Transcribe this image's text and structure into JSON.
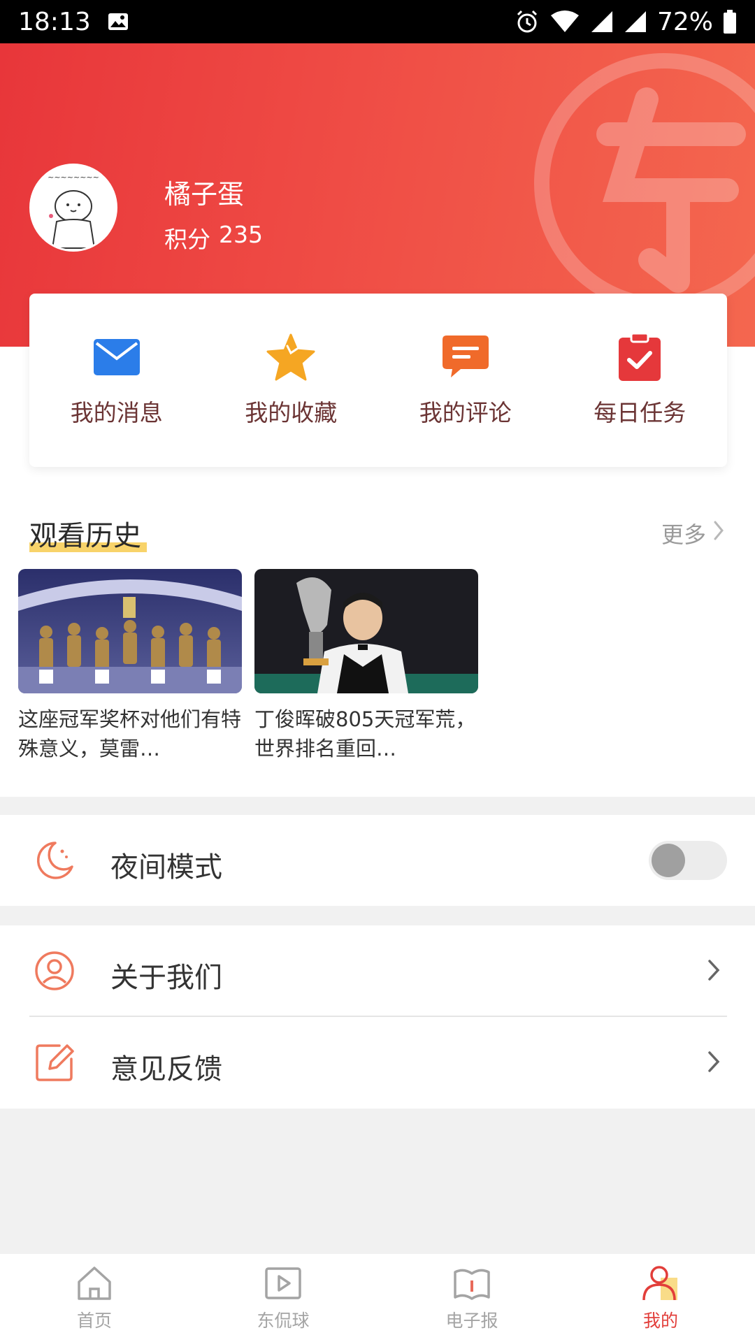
{
  "status_bar": {
    "time": "18:13",
    "battery": "72%"
  },
  "profile": {
    "name": "橘子蛋",
    "points_label": "积分",
    "points": "235"
  },
  "quick_actions": [
    {
      "label": "我的消息",
      "icon": "mail-icon",
      "color": "#2b7de9"
    },
    {
      "label": "我的收藏",
      "icon": "star-icon",
      "color": "#f5a623"
    },
    {
      "label": "我的评论",
      "icon": "comment-icon",
      "color": "#f06a2a"
    },
    {
      "label": "每日任务",
      "icon": "clipboard-check-icon",
      "color": "#e5383b"
    }
  ],
  "history": {
    "title": "观看历史",
    "more_label": "更多",
    "items": [
      {
        "title": "这座冠军奖杯对他们有特殊意义，莫雷…"
      },
      {
        "title": "丁俊晖破805天冠军荒，世界排名重回…"
      }
    ]
  },
  "settings": {
    "night_mode": {
      "label": "夜间模式",
      "enabled": false
    },
    "about": {
      "label": "关于我们"
    },
    "feedback": {
      "label": "意见反馈"
    }
  },
  "bottom_nav": [
    {
      "label": "首页",
      "icon": "home-icon",
      "active": false
    },
    {
      "label": "东侃球",
      "icon": "play-video-icon",
      "active": false
    },
    {
      "label": "电子报",
      "icon": "newspaper-icon",
      "active": false
    },
    {
      "label": "我的",
      "icon": "user-icon",
      "active": true
    }
  ],
  "colors": {
    "brand_red": "#e8363a",
    "accent_orange": "#f4674f",
    "highlight_yellow": "#f8d36a"
  }
}
